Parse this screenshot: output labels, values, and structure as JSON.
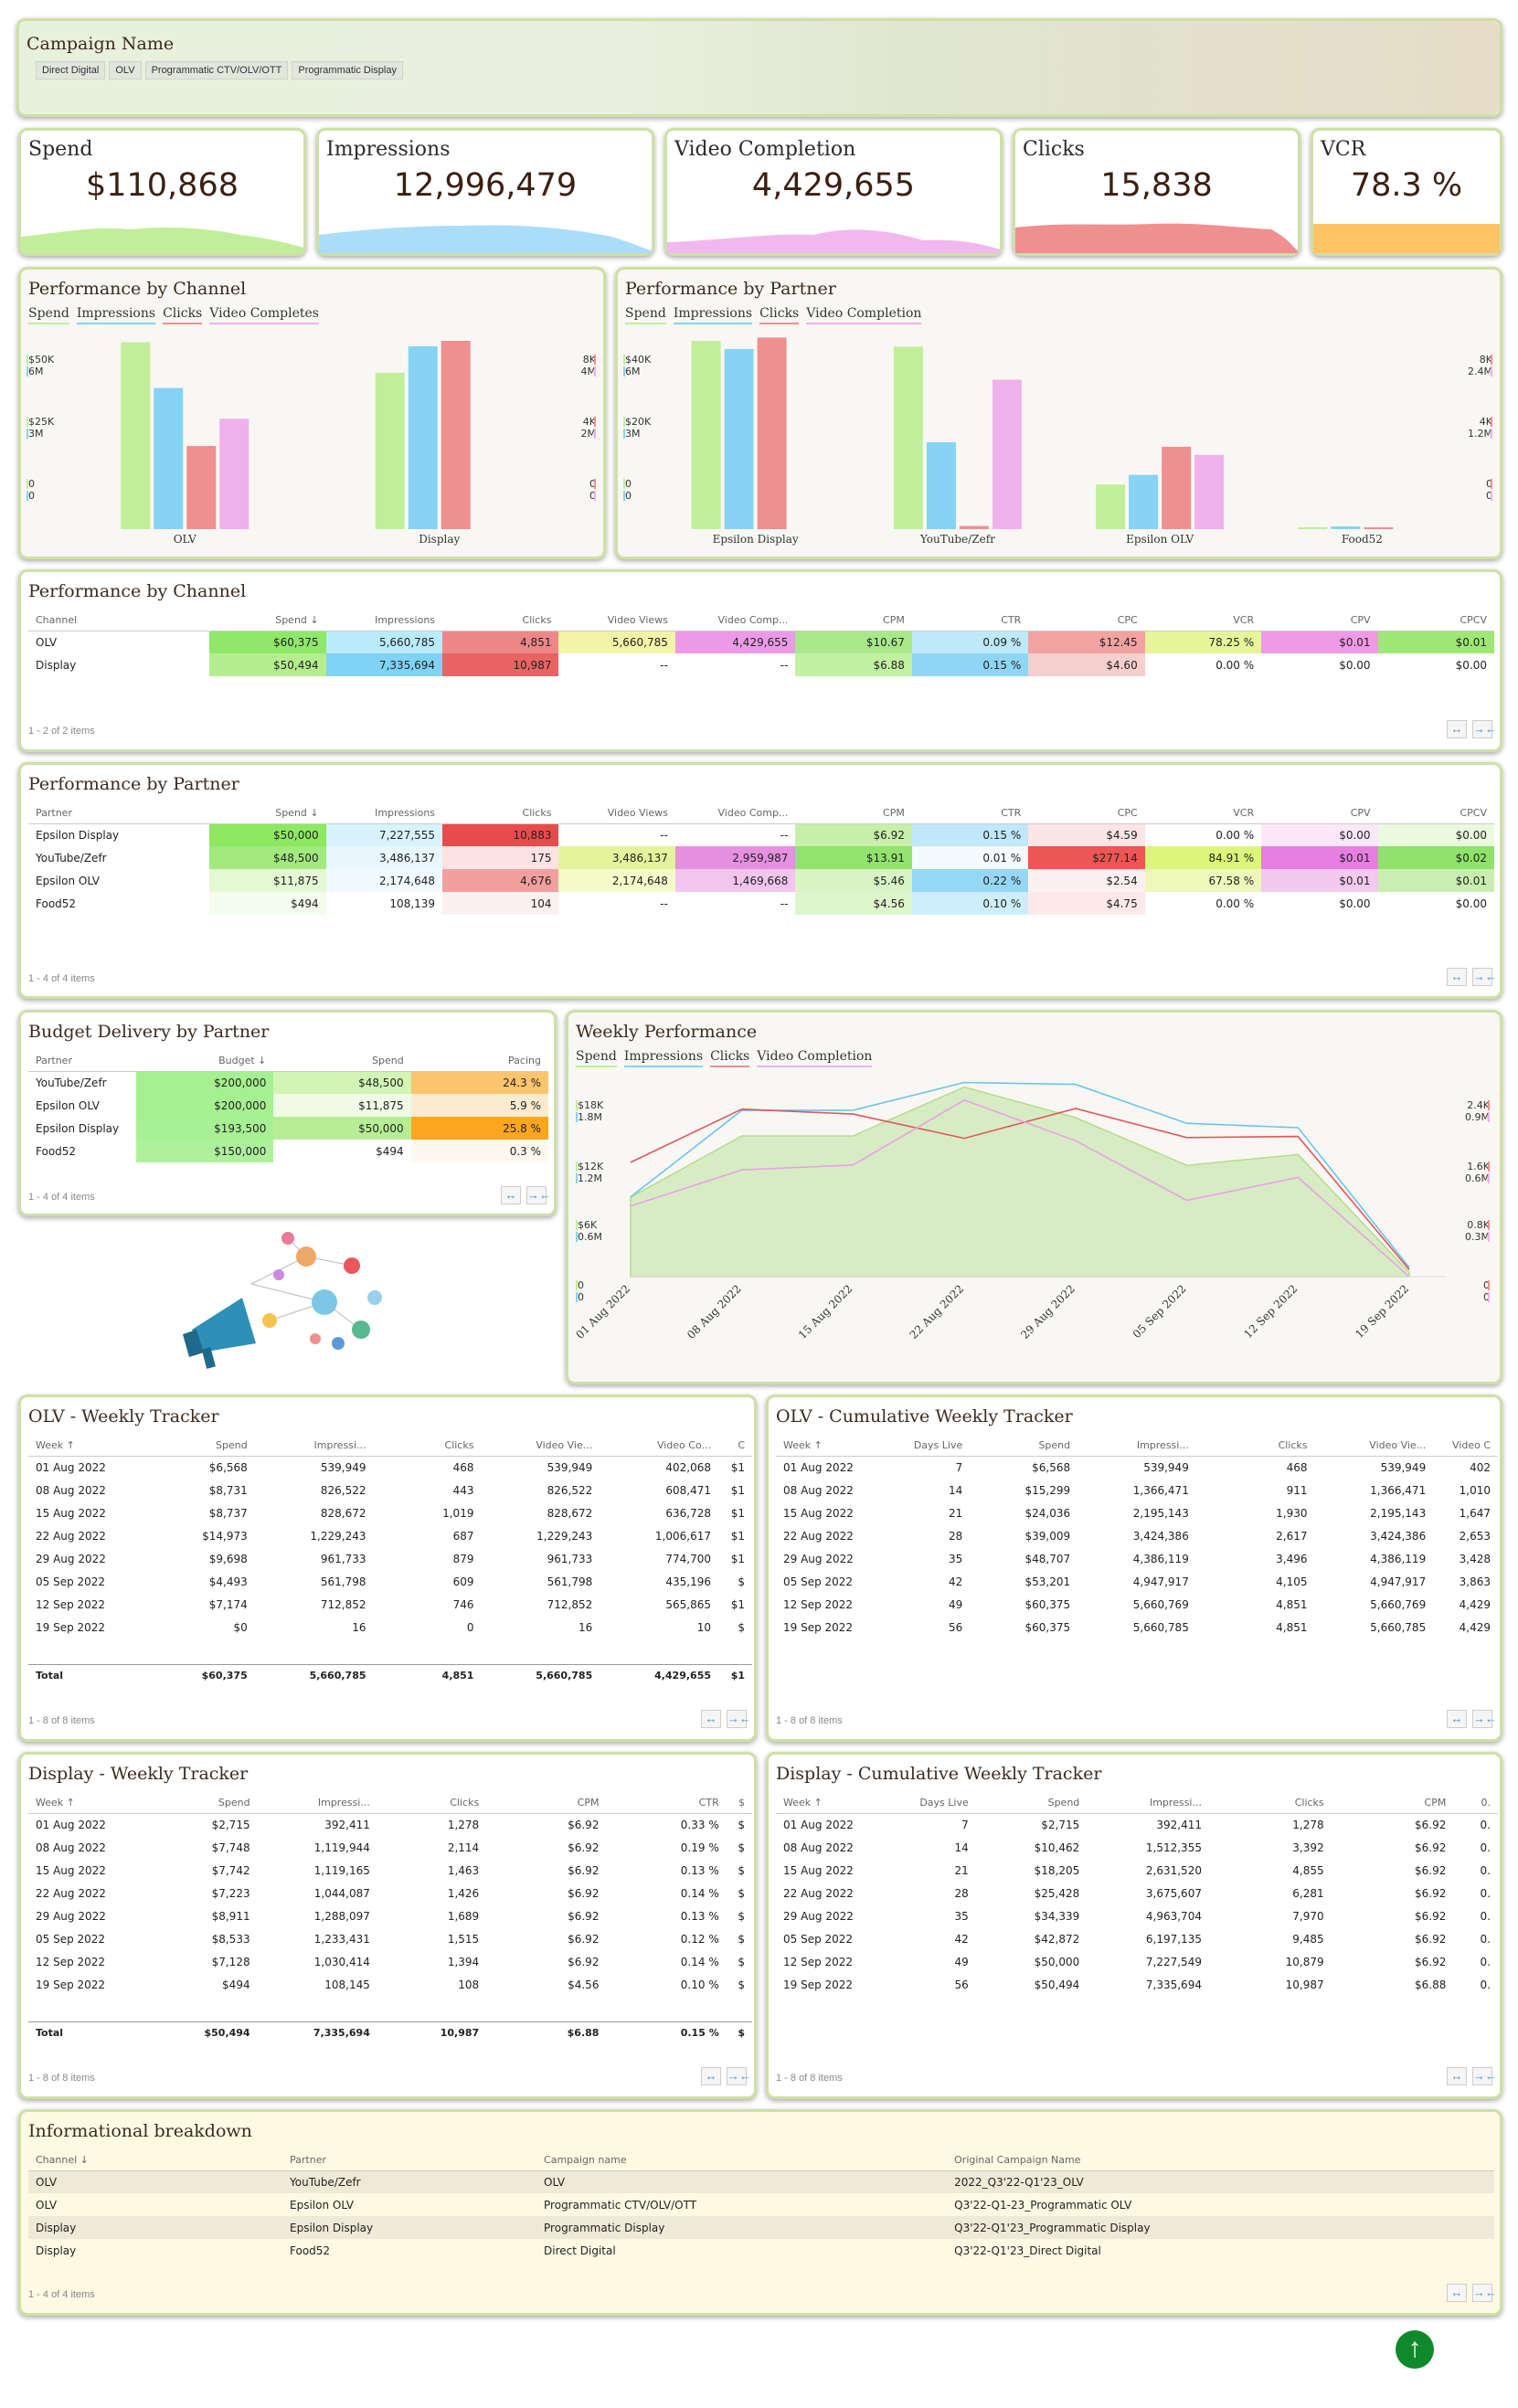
{
  "header": {
    "title": "Campaign Name",
    "tags": [
      "Direct Digital",
      "OLV",
      "Programmatic CTV/OLV/OTT",
      "Programmatic Display"
    ]
  },
  "kpis": [
    {
      "label": "Spend",
      "value": "$110,868",
      "color": "#c2ee9a"
    },
    {
      "label": "Impressions",
      "value": "12,996,479",
      "color": "#a9ddf8"
    },
    {
      "label": "Video Completion",
      "value": "4,429,655",
      "color": "#f1b8ee"
    },
    {
      "label": "Clicks",
      "value": "15,838",
      "color": "#f08f90"
    },
    {
      "label": "VCR",
      "value": "78.3 %",
      "color": "#fdc466"
    }
  ],
  "perf_channel_chart": {
    "title": "Performance by Channel",
    "legend": [
      "Spend",
      "Impressions",
      "Clicks",
      "Video Completes"
    ],
    "left_ticks": [
      {
        "a": "$50K",
        "b": "6M"
      },
      {
        "a": "$25K",
        "b": "3M"
      },
      {
        "a": "0",
        "b": "0"
      }
    ],
    "right_ticks": [
      {
        "a": "8K",
        "b": "4M"
      },
      {
        "a": "4K",
        "b": "2M"
      },
      {
        "a": "0",
        "b": "0"
      }
    ],
    "chart_data": {
      "type": "bar",
      "categories": [
        "OLV",
        "Display"
      ],
      "series": [
        {
          "name": "Spend",
          "values": [
            60375,
            50494
          ]
        },
        {
          "name": "Impressions",
          "values": [
            5660785,
            7335694
          ]
        },
        {
          "name": "Clicks",
          "values": [
            4851,
            10987
          ]
        },
        {
          "name": "Video Completes",
          "values": [
            4429655,
            0
          ]
        }
      ]
    }
  },
  "perf_partner_chart": {
    "title": "Performance by Partner",
    "legend": [
      "Spend",
      "Impressions",
      "Clicks",
      "Video Completion"
    ],
    "left_ticks": [
      {
        "a": "$40K",
        "b": "6M"
      },
      {
        "a": "$20K",
        "b": "3M"
      },
      {
        "a": "0",
        "b": "0"
      }
    ],
    "right_ticks": [
      {
        "a": "8K",
        "b": "2.4M"
      },
      {
        "a": "4K",
        "b": "1.2M"
      },
      {
        "a": "0",
        "b": "0"
      }
    ],
    "chart_data": {
      "type": "bar",
      "categories": [
        "Epsilon Display",
        "YouTube/Zefr",
        "Epsilon OLV",
        "Food52"
      ],
      "series": [
        {
          "name": "Spend",
          "values": [
            50000,
            48500,
            11875,
            494
          ]
        },
        {
          "name": "Impressions",
          "values": [
            7227555,
            3486137,
            2174648,
            108139
          ]
        },
        {
          "name": "Clicks",
          "values": [
            10883,
            175,
            4676,
            104
          ]
        },
        {
          "name": "Video Completion",
          "values": [
            0,
            2959987,
            1469668,
            0
          ]
        }
      ]
    }
  },
  "channel_table": {
    "title": "Performance by Channel",
    "columns": [
      "Channel",
      "Spend ↓",
      "Impressions",
      "Clicks",
      "Video Views",
      "Video Comp...",
      "CPM",
      "CTR",
      "CPC",
      "VCR",
      "CPV",
      "CPCV"
    ],
    "rows": [
      [
        "OLV",
        "$60,375",
        "5,660,785",
        "4,851",
        "5,660,785",
        "4,429,655",
        "$10.67",
        "0.09 %",
        "$12.45",
        "78.25 %",
        "$0.01",
        "$0.01"
      ],
      [
        "Display",
        "$50,494",
        "7,335,694",
        "10,987",
        "--",
        "--",
        "$6.88",
        "0.15 %",
        "$4.60",
        "0.00 %",
        "$0.00",
        "$0.00"
      ]
    ],
    "footer": "1 - 2 of 2 items"
  },
  "partner_table": {
    "title": "Performance by Partner",
    "columns": [
      "Partner",
      "Spend ↓",
      "Impressions",
      "Clicks",
      "Video Views",
      "Video Comp...",
      "CPM",
      "CTR",
      "CPC",
      "VCR",
      "CPV",
      "CPCV"
    ],
    "rows": [
      [
        "Epsilon Display",
        "$50,000",
        "7,227,555",
        "10,883",
        "--",
        "--",
        "$6.92",
        "0.15 %",
        "$4.59",
        "0.00 %",
        "$0.00",
        "$0.00"
      ],
      [
        "YouTube/Zefr",
        "$48,500",
        "3,486,137",
        "175",
        "3,486,137",
        "2,959,987",
        "$13.91",
        "0.01 %",
        "$277.14",
        "84.91 %",
        "$0.01",
        "$0.02"
      ],
      [
        "Epsilon OLV",
        "$11,875",
        "2,174,648",
        "4,676",
        "2,174,648",
        "1,469,668",
        "$5.46",
        "0.22 %",
        "$2.54",
        "67.58 %",
        "$0.01",
        "$0.01"
      ],
      [
        "Food52",
        "$494",
        "108,139",
        "104",
        "--",
        "--",
        "$4.56",
        "0.10 %",
        "$4.75",
        "0.00 %",
        "$0.00",
        "$0.00"
      ]
    ],
    "footer": "1 - 4 of 4 items"
  },
  "budget_table": {
    "title": "Budget Delivery by Partner",
    "columns": [
      "Partner",
      "Budget ↓",
      "Spend",
      "Pacing"
    ],
    "rows": [
      [
        "YouTube/Zefr",
        "$200,000",
        "$48,500",
        "24.3 %"
      ],
      [
        "Epsilon OLV",
        "$200,000",
        "$11,875",
        "5.9 %"
      ],
      [
        "Epsilon Display",
        "$193,500",
        "$50,000",
        "25.8 %"
      ],
      [
        "Food52",
        "$150,000",
        "$494",
        "0.3 %"
      ]
    ],
    "footer": "1 - 4 of 4 items"
  },
  "weekly_chart": {
    "title": "Weekly Performance",
    "legend": [
      "Spend",
      "Impressions",
      "Clicks",
      "Video Completion"
    ],
    "left_ticks": [
      {
        "a": "$18K",
        "b": "1.8M"
      },
      {
        "a": "$12K",
        "b": "1.2M"
      },
      {
        "a": "$6K",
        "b": "0.6M"
      },
      {
        "a": "0",
        "b": "0"
      }
    ],
    "right_ticks": [
      {
        "a": "2.4K",
        "b": "0.9M"
      },
      {
        "a": "1.6K",
        "b": "0.6M"
      },
      {
        "a": "0.8K",
        "b": "0.3M"
      },
      {
        "a": "0",
        "b": "0"
      }
    ],
    "chart_data": {
      "type": "line",
      "x": [
        "01 Aug 2022",
        "08 Aug 2022",
        "15 Aug 2022",
        "22 Aug 2022",
        "29 Aug 2022",
        "05 Sep 2022",
        "12 Sep 2022",
        "19 Sep 2022"
      ],
      "series": [
        {
          "name": "Spend",
          "values": [
            9283,
            16479,
            16479,
            22196,
            18609,
            13026,
            14302,
            494
          ]
        },
        {
          "name": "Impressions",
          "values": [
            932360,
            1946266,
            1947837,
            2273304,
            2250830,
            1795229,
            1743266,
            108155
          ]
        },
        {
          "name": "Clicks",
          "values": [
            1746,
            2557,
            2482,
            2113,
            2568,
            2124,
            2140,
            108
          ]
        },
        {
          "name": "Video Completion",
          "values": [
            402068,
            608471,
            636728,
            1006617,
            774700,
            435196,
            565865,
            10
          ]
        }
      ]
    }
  },
  "olv_weekly": {
    "title": "OLV - Weekly Tracker",
    "columns": [
      "Week ↑",
      "Spend",
      "Impressi...",
      "Clicks",
      "Video Vie...",
      "Video Co...",
      "C"
    ],
    "rows": [
      [
        "01 Aug 2022",
        "$6,568",
        "539,949",
        "468",
        "539,949",
        "402,068",
        "$1"
      ],
      [
        "08 Aug 2022",
        "$8,731",
        "826,522",
        "443",
        "826,522",
        "608,471",
        "$1"
      ],
      [
        "15 Aug 2022",
        "$8,737",
        "828,672",
        "1,019",
        "828,672",
        "636,728",
        "$1"
      ],
      [
        "22 Aug 2022",
        "$14,973",
        "1,229,243",
        "687",
        "1,229,243",
        "1,006,617",
        "$1"
      ],
      [
        "29 Aug 2022",
        "$9,698",
        "961,733",
        "879",
        "961,733",
        "774,700",
        "$1"
      ],
      [
        "05 Sep 2022",
        "$4,493",
        "561,798",
        "609",
        "561,798",
        "435,196",
        "$"
      ],
      [
        "12 Sep 2022",
        "$7,174",
        "712,852",
        "746",
        "712,852",
        "565,865",
        "$1"
      ],
      [
        "19 Sep 2022",
        "$0",
        "16",
        "0",
        "16",
        "10",
        "$"
      ]
    ],
    "total": [
      "Total",
      "$60,375",
      "5,660,785",
      "4,851",
      "5,660,785",
      "4,429,655",
      "$1"
    ],
    "footer": "1 - 8 of 8 items"
  },
  "olv_cumulative": {
    "title": "OLV - Cumulative Weekly Tracker",
    "columns": [
      "Week ↑",
      "Days Live",
      "Spend",
      "Impressi...",
      "Clicks",
      "Video Vie...",
      "Video C"
    ],
    "rows": [
      [
        "01 Aug 2022",
        "7",
        "$6,568",
        "539,949",
        "468",
        "539,949",
        "402"
      ],
      [
        "08 Aug 2022",
        "14",
        "$15,299",
        "1,366,471",
        "911",
        "1,366,471",
        "1,010"
      ],
      [
        "15 Aug 2022",
        "21",
        "$24,036",
        "2,195,143",
        "1,930",
        "2,195,143",
        "1,647"
      ],
      [
        "22 Aug 2022",
        "28",
        "$39,009",
        "3,424,386",
        "2,617",
        "3,424,386",
        "2,653"
      ],
      [
        "29 Aug 2022",
        "35",
        "$48,707",
        "4,386,119",
        "3,496",
        "4,386,119",
        "3,428"
      ],
      [
        "05 Sep 2022",
        "42",
        "$53,201",
        "4,947,917",
        "4,105",
        "4,947,917",
        "3,863"
      ],
      [
        "12 Sep 2022",
        "49",
        "$60,375",
        "5,660,769",
        "4,851",
        "5,660,769",
        "4,429"
      ],
      [
        "19 Sep 2022",
        "56",
        "$60,375",
        "5,660,785",
        "4,851",
        "5,660,785",
        "4,429"
      ]
    ],
    "footer": "1 - 8 of 8 items"
  },
  "display_weekly": {
    "title": "Display - Weekly Tracker",
    "columns": [
      "Week ↑",
      "Spend",
      "Impressi...",
      "Clicks",
      "CPM",
      "CTR",
      "$"
    ],
    "rows": [
      [
        "01 Aug 2022",
        "$2,715",
        "392,411",
        "1,278",
        "$6.92",
        "0.33 %",
        "$"
      ],
      [
        "08 Aug 2022",
        "$7,748",
        "1,119,944",
        "2,114",
        "$6.92",
        "0.19 %",
        "$"
      ],
      [
        "15 Aug 2022",
        "$7,742",
        "1,119,165",
        "1,463",
        "$6.92",
        "0.13 %",
        "$"
      ],
      [
        "22 Aug 2022",
        "$7,223",
        "1,044,087",
        "1,426",
        "$6.92",
        "0.14 %",
        "$"
      ],
      [
        "29 Aug 2022",
        "$8,911",
        "1,288,097",
        "1,689",
        "$6.92",
        "0.13 %",
        "$"
      ],
      [
        "05 Sep 2022",
        "$8,533",
        "1,233,431",
        "1,515",
        "$6.92",
        "0.12 %",
        "$"
      ],
      [
        "12 Sep 2022",
        "$7,128",
        "1,030,414",
        "1,394",
        "$6.92",
        "0.14 %",
        "$"
      ],
      [
        "19 Sep 2022",
        "$494",
        "108,145",
        "108",
        "$4.56",
        "0.10 %",
        "$"
      ]
    ],
    "total": [
      "Total",
      "$50,494",
      "7,335,694",
      "10,987",
      "$6.88",
      "0.15 %",
      "$"
    ],
    "footer": "1 - 8 of 8 items"
  },
  "display_cumulative": {
    "title": "Display - Cumulative Weekly Tracker",
    "columns": [
      "Week ↑",
      "Days Live",
      "Spend",
      "Impressi...",
      "Clicks",
      "CPM",
      "0."
    ],
    "rows": [
      [
        "01 Aug 2022",
        "7",
        "$2,715",
        "392,411",
        "1,278",
        "$6.92",
        "0."
      ],
      [
        "08 Aug 2022",
        "14",
        "$10,462",
        "1,512,355",
        "3,392",
        "$6.92",
        "0."
      ],
      [
        "15 Aug 2022",
        "21",
        "$18,205",
        "2,631,520",
        "4,855",
        "$6.92",
        "0."
      ],
      [
        "22 Aug 2022",
        "28",
        "$25,428",
        "3,675,607",
        "6,281",
        "$6.92",
        "0."
      ],
      [
        "29 Aug 2022",
        "35",
        "$34,339",
        "4,963,704",
        "7,970",
        "$6.92",
        "0."
      ],
      [
        "05 Sep 2022",
        "42",
        "$42,872",
        "6,197,135",
        "9,485",
        "$6.92",
        "0."
      ],
      [
        "12 Sep 2022",
        "49",
        "$50,000",
        "7,227,549",
        "10,879",
        "$6.92",
        "0."
      ],
      [
        "19 Sep 2022",
        "56",
        "$50,494",
        "7,335,694",
        "10,987",
        "$6.88",
        "0."
      ]
    ],
    "footer": "1 - 8 of 8 items"
  },
  "info_table": {
    "title": "Informational breakdown",
    "columns": [
      "Channel ↓",
      "Partner",
      "Campaign name",
      "Original Campaign Name"
    ],
    "rows": [
      [
        "OLV",
        "YouTube/Zefr",
        "OLV",
        "2022_Q3'22-Q1'23_OLV"
      ],
      [
        "OLV",
        "Epsilon OLV",
        "Programmatic CTV/OLV/OTT",
        "Q3'22-Q1-23_Programmatic OLV"
      ],
      [
        "Display",
        "Epsilon Display",
        "Programmatic Display",
        "Q3'22-Q1'23_Programmatic Display"
      ],
      [
        "Display",
        "Food52",
        "Direct Digital",
        "Q3'22-Q1'23_Direct Digital"
      ]
    ],
    "footer": "1 - 4 of 4 items"
  },
  "colors": {
    "spend": "#c2ee9a",
    "impressions": "#86d3f5",
    "clicks": "#f08f90",
    "video": "#efb1ec",
    "vcr": "#fdc466"
  }
}
